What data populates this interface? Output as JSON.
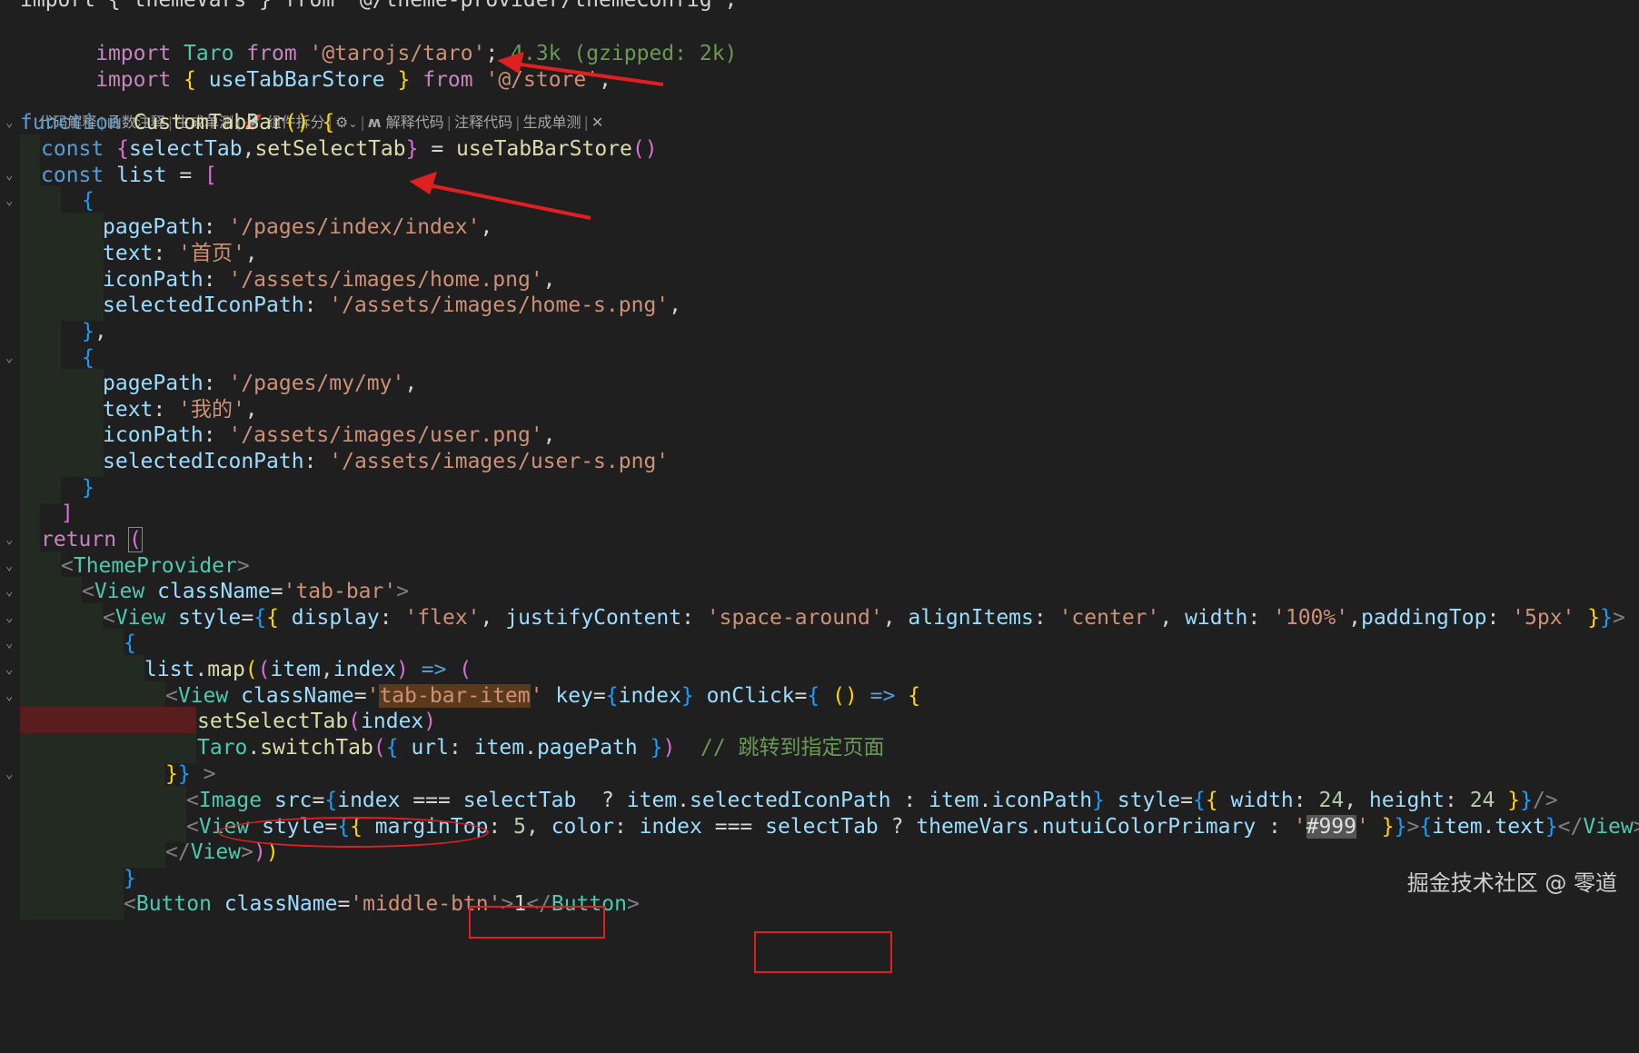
{
  "code": {
    "import_line1_visible_fragment": "import { themeVars } from '@/theme-provider/themeConfig';",
    "import_line2": {
      "kw_import": "import",
      "name": "Taro",
      "kw_from": "from",
      "path": "'@tarojs/taro'",
      "semicolon": ";",
      "size_hint": "4.3k (gzipped: 2k)"
    },
    "import_line3": {
      "kw_import": "import",
      "open": "{",
      "name": "useTabBarStore",
      "close": "}",
      "kw_from": "from",
      "path": "'@/store'",
      "semicolon": ";"
    },
    "codelens": {
      "items_left": [
        "代码解释",
        "函数注释",
        "生成单测"
      ],
      "rocket_label": "组件拆分",
      "dropdown_label": "",
      "items_right": [
        "解释代码",
        "注释代码",
        "生成单测"
      ],
      "separator": "|",
      "close": "✕"
    },
    "function_kw": "function",
    "function_name": "CustomTabBar",
    "const_kw": "const",
    "select_tab": "selectTab",
    "set_select_tab": "setSelectTab",
    "use_store_call": "useTabBarStore",
    "list_name": "list",
    "items": [
      {
        "pagePath_key": "pagePath",
        "pagePath": "'/pages/index/index'",
        "text_key": "text",
        "text": "'首页'",
        "iconPath_key": "iconPath",
        "iconPath": "'/assets/images/home.png'",
        "selectedIconPath_key": "selectedIconPath",
        "selectedIconPath": "'/assets/images/home-s.png'"
      },
      {
        "pagePath_key": "pagePath",
        "pagePath": "'/pages/my/my'",
        "text_key": "text",
        "text": "'我的'",
        "iconPath_key": "iconPath",
        "iconPath": "'/assets/images/user.png'",
        "selectedIconPath_key": "selectedIconPath",
        "selectedIconPath": "'/assets/images/user-s.png'"
      }
    ],
    "return_kw": "return",
    "theme_provider": "ThemeProvider",
    "view": "View",
    "classname_attr": "className",
    "tab_bar_class": "'tab-bar'",
    "style_attr": "style",
    "style_line": {
      "display_key": "display",
      "display_val": "'flex'",
      "jc_key": "justifyContent",
      "jc_val": "'space-around'",
      "ai_key": "alignItems",
      "ai_val": "'center'",
      "w_key": "width",
      "w_val": "'100%'",
      "pt_key": "paddingTop",
      "pt_val": "'5px'"
    },
    "map_call": "map",
    "item_param": "item",
    "index_param": "index",
    "tab_bar_item_class": "tab-bar-item",
    "key_attr": "key",
    "onclick_attr": "onClick",
    "taro": "Taro",
    "switch_tab": "switchTab",
    "url_key": "url",
    "page_path": "pagePath",
    "comment": "// 跳转到指定页面",
    "image_tag": "Image",
    "src_attr": "src",
    "selected_icon_path": "selectedIconPath",
    "icon_path": "iconPath",
    "width_key": "width",
    "height_key": "height",
    "num_24": "24",
    "margin_top_key": "marginTop",
    "num_5": "5",
    "color_key": "color",
    "theme_vars": "themeVars",
    "nutui_color": "nutuiColorPrimary",
    "color_999": "#999",
    "text_prop": "text",
    "button_tag": "Button",
    "middle_btn": "'middle-btn'",
    "button_text": "1"
  },
  "watermark": "掘金技术社区 @ 零道",
  "colors": {
    "background": "#1f1f1f",
    "annotation_red": "#e02020"
  }
}
